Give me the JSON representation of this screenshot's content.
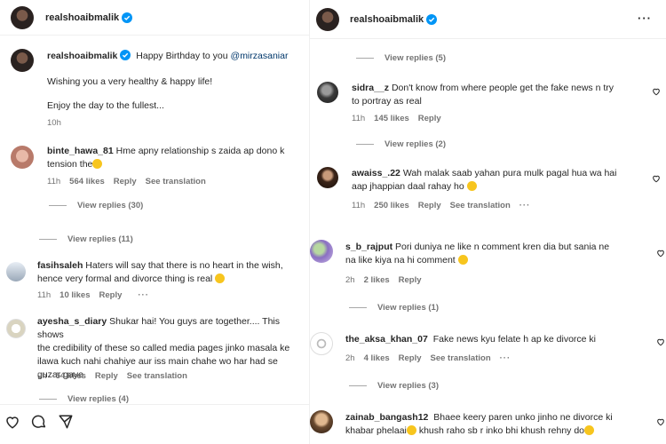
{
  "left": {
    "header": {
      "username": "realshoaibmalik"
    },
    "caption": {
      "username": "realshoaibmalik",
      "greeting": "Happy Birthday to you",
      "mention": "@mirzasaniar",
      "line1": "Wishing you a very healthy & happy life!",
      "line2": "Enjoy the day to the fullest...",
      "time": "10h"
    },
    "comments": [
      {
        "username": "binte_hawa_81",
        "text_1": "Hme apny relationship s zaida ap dono k",
        "text_2": "tension the",
        "time": "11h",
        "likes": "564 likes",
        "reply": "Reply",
        "translate": "See translation",
        "view_replies": "View replies (30)"
      },
      {
        "view_replies": "View replies (11)"
      },
      {
        "username": "fasihsaleh",
        "text_1": "Haters will say that there is no heart in the wish,",
        "text_2": "hence very formal and divorce thing is real",
        "time": "11h",
        "likes": "10 likes",
        "reply": "Reply",
        "more": "···"
      },
      {
        "username": "ayesha_s_diary",
        "text_1": "Shukar hai! You guys are together.... This shows",
        "text_2": "the credibility of these so called media pages jinko masala ke",
        "text_3": "ilawa kuch nahi chahiye aur iss main chahe wo har had se",
        "text_4": "guzar gaye",
        "time": "9h",
        "likes": "54 likes",
        "reply": "Reply",
        "translate": "See translation",
        "view_replies": "View replies (4)"
      }
    ]
  },
  "right": {
    "header": {
      "username": "realshoaibmalik",
      "more": "···"
    },
    "top_view_replies": "View replies (5)",
    "comments": [
      {
        "username": "sidra__z",
        "text_1": "Don't know from where people get the fake news n try",
        "text_2": "to portray as real",
        "time": "11h",
        "likes": "145 likes",
        "reply": "Reply",
        "view_replies": "View replies (2)"
      },
      {
        "username": "awaiss_.22",
        "text_1": "Wah malak saab yahan pura mulk pagal hua wa hai",
        "text_2": "aap jhappian daal rahay ho",
        "time": "11h",
        "likes": "250 likes",
        "reply": "Reply",
        "translate": "See translation",
        "more": "···"
      },
      {
        "username": "s_b_rajput",
        "text_1": "Pori duniya ne like n comment kren dia but sania ne",
        "text_2": "na like kiya na hi comment",
        "time": "2h",
        "likes": "2 likes",
        "reply": "Reply",
        "view_replies": "View replies (1)"
      },
      {
        "username": "the_aksa_khan_07",
        "text_1": "Fake news kyu felate h ap ke divorce ki",
        "time": "2h",
        "likes": "4 likes",
        "reply": "Reply",
        "translate": "See translation",
        "more": "···",
        "view_replies": "View replies (3)"
      },
      {
        "username": "zainab_bangash12",
        "text_1": "Bhaee keery paren unko jinho ne divorce ki",
        "text_2": "khabar phelaai",
        "text_3": "khush raho sb r inko bhi khush rehny do"
      }
    ]
  },
  "colors": {
    "link": "#00376b",
    "verified": "#0095f6",
    "secondary": "#737373",
    "reaction": "#f7c51e"
  }
}
